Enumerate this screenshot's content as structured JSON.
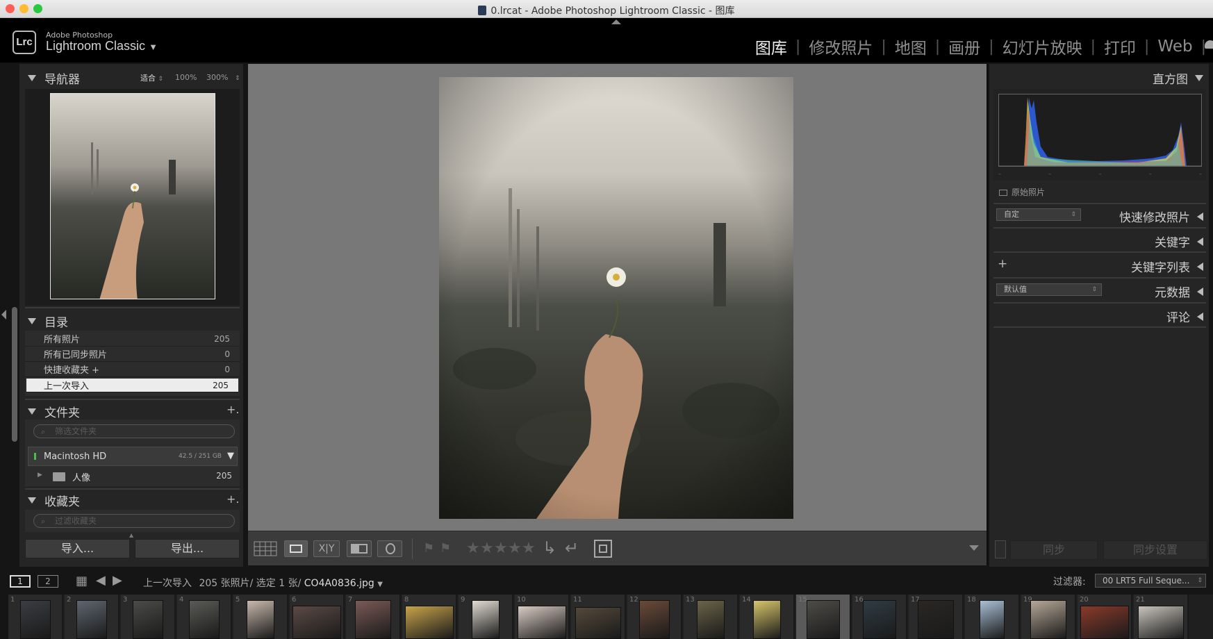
{
  "window": {
    "title": "0.lrcat - Adobe Photoshop Lightroom Classic - 图库"
  },
  "identity": {
    "logo": "Lrc",
    "brand_top": "Adobe Photoshop",
    "brand_name": "Lightroom Classic"
  },
  "modules": [
    {
      "label": "图库",
      "active": true
    },
    {
      "label": "修改照片",
      "active": false
    },
    {
      "label": "地图",
      "active": false
    },
    {
      "label": "画册",
      "active": false
    },
    {
      "label": "幻灯片放映",
      "active": false
    },
    {
      "label": "打印",
      "active": false
    },
    {
      "label": "Web",
      "active": false
    }
  ],
  "navigator": {
    "title": "导航器",
    "zoom_fit": "适合",
    "zoom_100": "100%",
    "zoom_300": "300%"
  },
  "catalog": {
    "title": "目录",
    "items": [
      {
        "label": "所有照片",
        "count": "205"
      },
      {
        "label": "所有已同步照片",
        "count": "0"
      },
      {
        "label": "快捷收藏夹 +",
        "count": "0"
      },
      {
        "label": "上一次导入",
        "count": "205",
        "selected": true
      }
    ]
  },
  "folders": {
    "title": "文件夹",
    "add": "+.",
    "search_placeholder": "筛选文件夹",
    "volume": {
      "name": "Macintosh HD",
      "space": "42.5 / 251 GB"
    },
    "items": [
      {
        "label": "人像",
        "count": "205"
      }
    ]
  },
  "collections": {
    "title": "收藏夹",
    "add": "+.",
    "search_placeholder": "过滤收藏夹"
  },
  "left_buttons": {
    "import": "导入...",
    "export": "导出..."
  },
  "right_panel": {
    "histogram_title": "直方图",
    "original_photo": "原始照片",
    "quick_develop": {
      "title": "快速修改照片",
      "preset": "自定"
    },
    "keywording": "关键字",
    "keyword_list": {
      "title": "关键字列表",
      "add": "+"
    },
    "metadata": {
      "title": "元数据",
      "preset": "默认值"
    },
    "comments": "评论",
    "sync": "同步",
    "sync_settings": "同步设置"
  },
  "toolbar": {
    "stars": [
      "★",
      "★",
      "★",
      "★",
      "★"
    ]
  },
  "filmstrip_bar": {
    "monitor1": "1",
    "monitor2": "2",
    "source": "上一次导入",
    "count_info": "205 张照片/ 选定 1 张/",
    "filename": "CO4A0836.jpg",
    "filter_label": "过滤器:",
    "filter_value": "00 LRT5 Full Seque..."
  },
  "filmstrip": [
    {
      "n": "1",
      "c": "#3a3d42",
      "w": 44,
      "h": 56
    },
    {
      "n": "2",
      "c": "#5f6670",
      "w": 44,
      "h": 56
    },
    {
      "n": "3",
      "c": "#4b4c48",
      "w": 44,
      "h": 56
    },
    {
      "n": "4",
      "c": "#5a5a56",
      "w": 44,
      "h": 56
    },
    {
      "n": "5",
      "c": "#c9b9ac",
      "w": 40,
      "h": 56
    },
    {
      "n": "6",
      "c": "#5b4a44",
      "w": 70,
      "h": 48
    },
    {
      "n": "7",
      "c": "#7a5a56",
      "w": 52,
      "h": 56
    },
    {
      "n": "8",
      "c": "#c8a34a",
      "w": 70,
      "h": 48
    },
    {
      "n": "9",
      "c": "#e2dcd2",
      "w": 40,
      "h": 56
    },
    {
      "n": "10",
      "c": "#d9ccc4",
      "w": 70,
      "h": 48
    },
    {
      "n": "11",
      "c": "#54493a",
      "w": 66,
      "h": 46
    },
    {
      "n": "12",
      "c": "#6b4a38",
      "w": 44,
      "h": 56
    },
    {
      "n": "13",
      "c": "#6a6448",
      "w": 40,
      "h": 56
    },
    {
      "n": "14",
      "c": "#d8c66a",
      "w": 40,
      "h": 56
    },
    {
      "n": "15",
      "c": "#4e4c48",
      "w": 48,
      "h": 56,
      "sel": true
    },
    {
      "n": "16",
      "c": "#2f3c44",
      "w": 48,
      "h": 56
    },
    {
      "n": "17",
      "c": "#2a2724",
      "w": 52,
      "h": 56
    },
    {
      "n": "18",
      "c": "#a9c0d6",
      "w": 36,
      "h": 56
    },
    {
      "n": "19",
      "c": "#b7a898",
      "w": 52,
      "h": 56
    },
    {
      "n": "20",
      "c": "#8a3a2a",
      "w": 70,
      "h": 48
    },
    {
      "n": "21",
      "c": "#c9c4bd",
      "w": 66,
      "h": 48
    }
  ]
}
